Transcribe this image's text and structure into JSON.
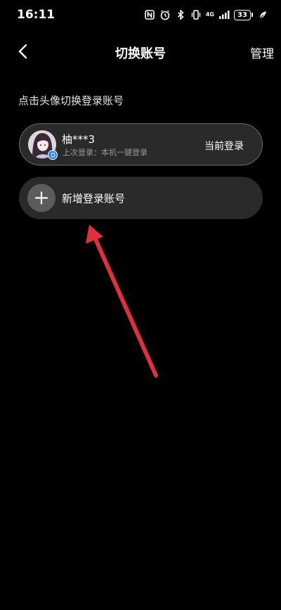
{
  "status_bar": {
    "time": "16:11",
    "network": "4G",
    "battery": "33"
  },
  "header": {
    "title": "切换账号",
    "manage": "管理"
  },
  "hint": "点击头像切换登录账号",
  "account": {
    "name": "柚***3",
    "subtitle": "上次登录：本机一键登录",
    "status": "当前登录"
  },
  "add_account": {
    "label": "新增登录账号"
  },
  "colors": {
    "background": "#000000",
    "card": "#2a2a2a",
    "arrow": "#e0303a",
    "badge": "#2c86ff"
  }
}
